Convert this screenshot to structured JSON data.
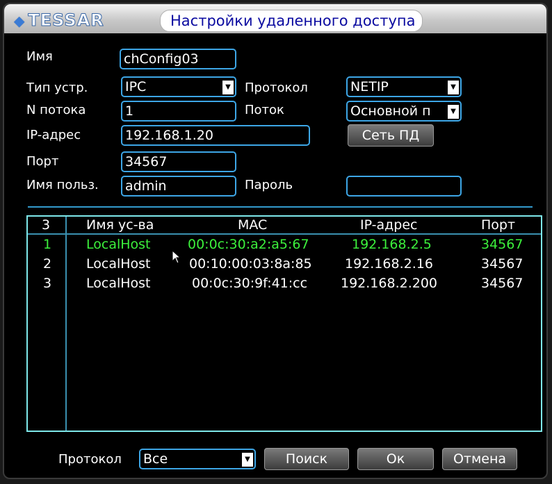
{
  "window": {
    "brand": "TESSAR",
    "title": "Настройки удаленного доступа"
  },
  "form": {
    "name_label": "Имя",
    "name_value": "chConfig03",
    "device_type_label": "Тип устр.",
    "device_type_value": "IPC",
    "protocol_label": "Протокол",
    "protocol_value": "NETIP",
    "channel_label": "N потока",
    "channel_value": "1",
    "stream_label": "Поток",
    "stream_value": "Основной п",
    "ip_label": "IP-адрес",
    "ip_value": "192.168.1.20",
    "network_button": "Сеть ПД",
    "port_label": "Порт",
    "port_value": "34567",
    "user_label": "Имя польз.",
    "user_value": "admin",
    "password_label": "Пароль",
    "password_value": ""
  },
  "device_list": {
    "columns": [
      "3",
      "Имя ус-ва",
      "MAC",
      "IP-адрес",
      "Порт"
    ],
    "selected_index": 0,
    "rows": [
      {
        "num": "1",
        "name": "LocalHost",
        "mac": "00:0c:30:a2:a5:67",
        "ip": "192.168.2.5",
        "port": "34567"
      },
      {
        "num": "2",
        "name": "LocalHost",
        "mac": "00:10:00:03:8a:85",
        "ip": "192.168.2.16",
        "port": "34567"
      },
      {
        "num": "3",
        "name": "LocalHost",
        "mac": "00:0c:30:9f:41:cc",
        "ip": "192.168.2.200",
        "port": "34567"
      }
    ]
  },
  "footer": {
    "protocol_label": "Протокол",
    "protocol_value": "Все",
    "search_button": "Поиск",
    "ok_button": "Ок",
    "cancel_button": "Отмена"
  },
  "colors": {
    "accent": "#3da6e6",
    "selected_row": "#3cf03c",
    "title_text": "#0a0aa0"
  }
}
